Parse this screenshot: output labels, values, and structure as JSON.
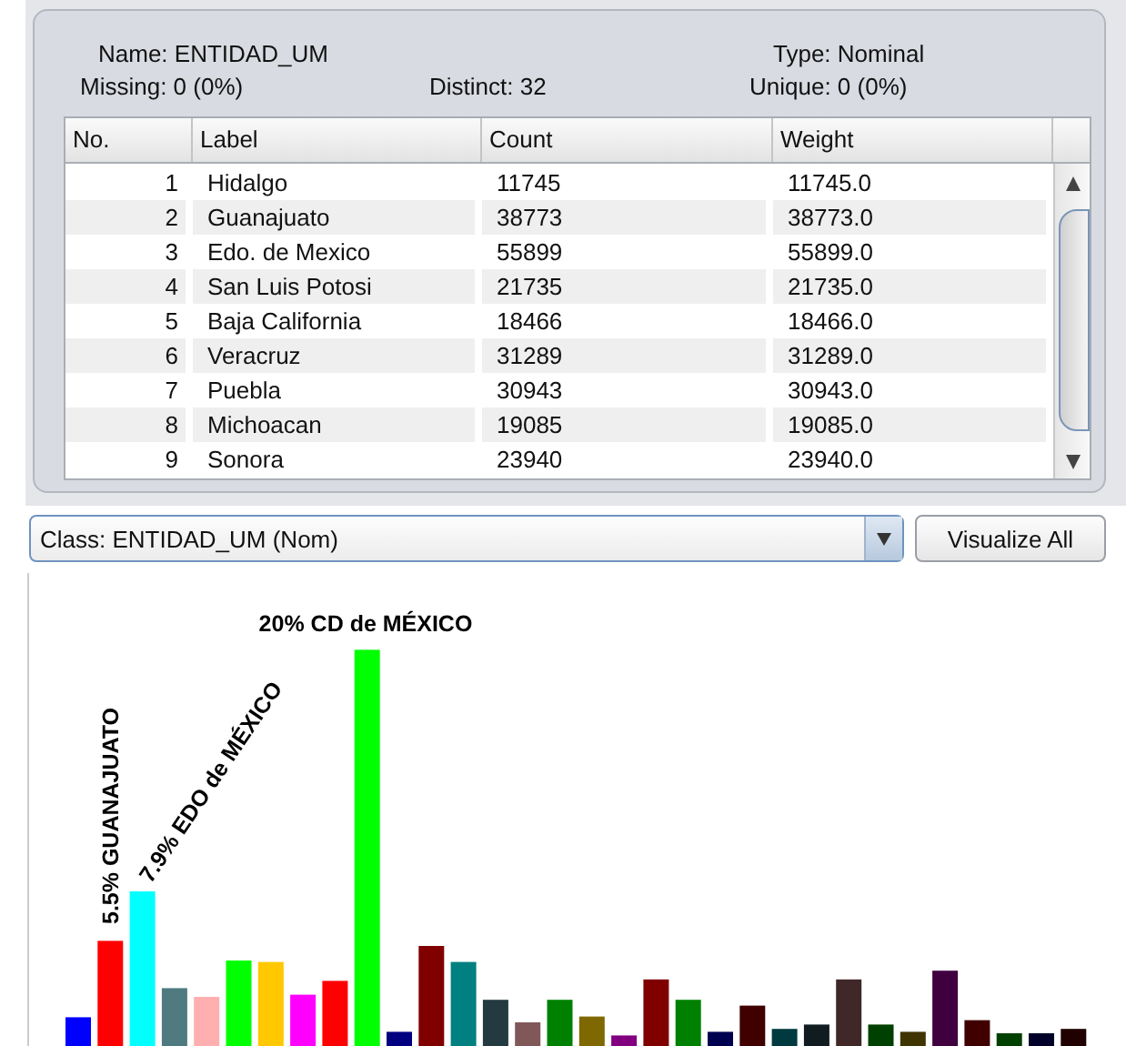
{
  "attribute": {
    "name_label": "Name:",
    "name": "ENTIDAD_UM",
    "type_label": "Type:",
    "type": "Nominal",
    "missing_label": "Missing:",
    "missing": "0 (0%)",
    "distinct_label": "Distinct:",
    "distinct": "32",
    "unique_label": "Unique:",
    "unique": "0 (0%)"
  },
  "table": {
    "columns": [
      "No.",
      "Label",
      "Count",
      "Weight"
    ],
    "rows": [
      {
        "no": "1",
        "label": "Hidalgo",
        "count": "11745",
        "weight": "11745.0"
      },
      {
        "no": "2",
        "label": "Guanajuato",
        "count": "38773",
        "weight": "38773.0"
      },
      {
        "no": "3",
        "label": "Edo. de Mexico",
        "count": "55899",
        "weight": "55899.0"
      },
      {
        "no": "4",
        "label": "San Luis Potosi",
        "count": "21735",
        "weight": "21735.0"
      },
      {
        "no": "5",
        "label": "Baja California",
        "count": "18466",
        "weight": "18466.0"
      },
      {
        "no": "6",
        "label": "Veracruz",
        "count": "31289",
        "weight": "31289.0"
      },
      {
        "no": "7",
        "label": "Puebla",
        "count": "30943",
        "weight": "30943.0"
      },
      {
        "no": "8",
        "label": "Michoacan",
        "count": "19085",
        "weight": "19085.0"
      },
      {
        "no": "9",
        "label": "Sonora",
        "count": "23940",
        "weight": "23940.0"
      }
    ]
  },
  "class_select": {
    "value": "Class: ENTIDAD_UM (Nom)"
  },
  "visualize_button": "Visualize All",
  "chart_labels": [
    {
      "kind": "vertical",
      "text": "5.5% GUANAJUATO"
    },
    {
      "kind": "diagonal",
      "text": "7.9% EDO de MÉXICO"
    },
    {
      "kind": "horizontal",
      "text": "20% CD de MÉXICO"
    }
  ]
}
